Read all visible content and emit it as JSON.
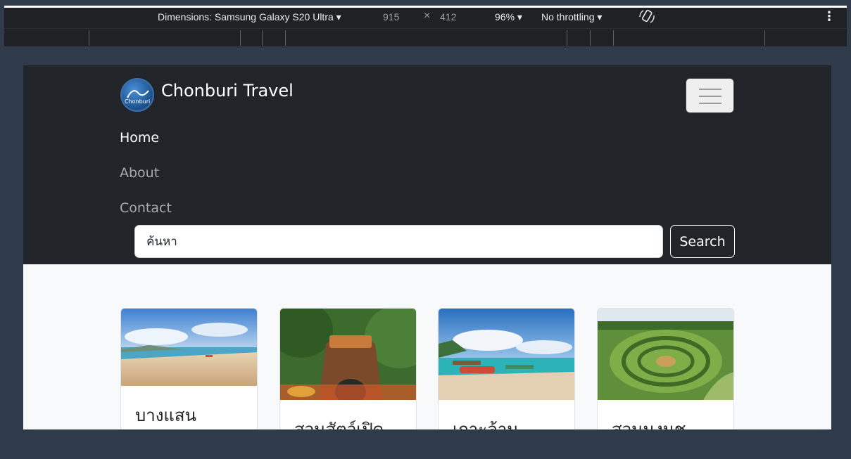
{
  "devtools": {
    "dimensions_label": "Dimensions: Samsung Galaxy S20 Ultra ▾",
    "width": "915",
    "times": "×",
    "height": "412",
    "zoom": "96% ▾",
    "throttling": "No throttling ▾",
    "more_icon": "⋮"
  },
  "navbar": {
    "brand_name": "Chonburi Travel",
    "logo_text": "Chonburi",
    "links": [
      "Home",
      "About",
      "Contact"
    ],
    "search_placeholder": "ค้นหา",
    "search_button": "Search"
  },
  "cards": [
    {
      "title": "บางแสน"
    },
    {
      "title": "สวนสัตว์เปิด"
    },
    {
      "title": "เกาะล้าน"
    },
    {
      "title": "สวนนงนุช"
    }
  ],
  "colors": {
    "navbar_bg": "#212529",
    "page_bg": "#f8f9fa",
    "devtools_bg": "#202124",
    "outer_bg": "#2f3b4a"
  }
}
